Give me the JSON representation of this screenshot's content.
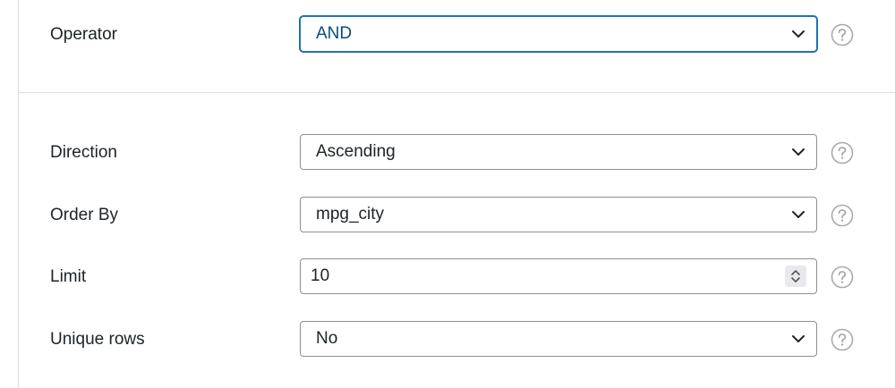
{
  "operator": {
    "label": "Operator",
    "value": "AND",
    "icon": "chevron-down-icon",
    "help_icon": "help-icon"
  },
  "direction": {
    "label": "Direction",
    "value": "Ascending",
    "icon": "chevron-down-icon",
    "help_icon": "help-icon"
  },
  "order_by": {
    "label": "Order By",
    "value": "mpg_city",
    "icon": "chevron-down-icon",
    "help_icon": "help-icon"
  },
  "limit": {
    "label": "Limit",
    "value": "10",
    "icon": "spinner-icon",
    "help_icon": "help-icon"
  },
  "unique_rows": {
    "label": "Unique rows",
    "value": "No",
    "icon": "chevron-down-icon",
    "help_icon": "help-icon"
  },
  "colors": {
    "focus_border": "#2271b1",
    "border": "#8c8f94",
    "divider": "#dcdcde",
    "text": "#1d2327",
    "help_icon": "#a7aaad"
  }
}
